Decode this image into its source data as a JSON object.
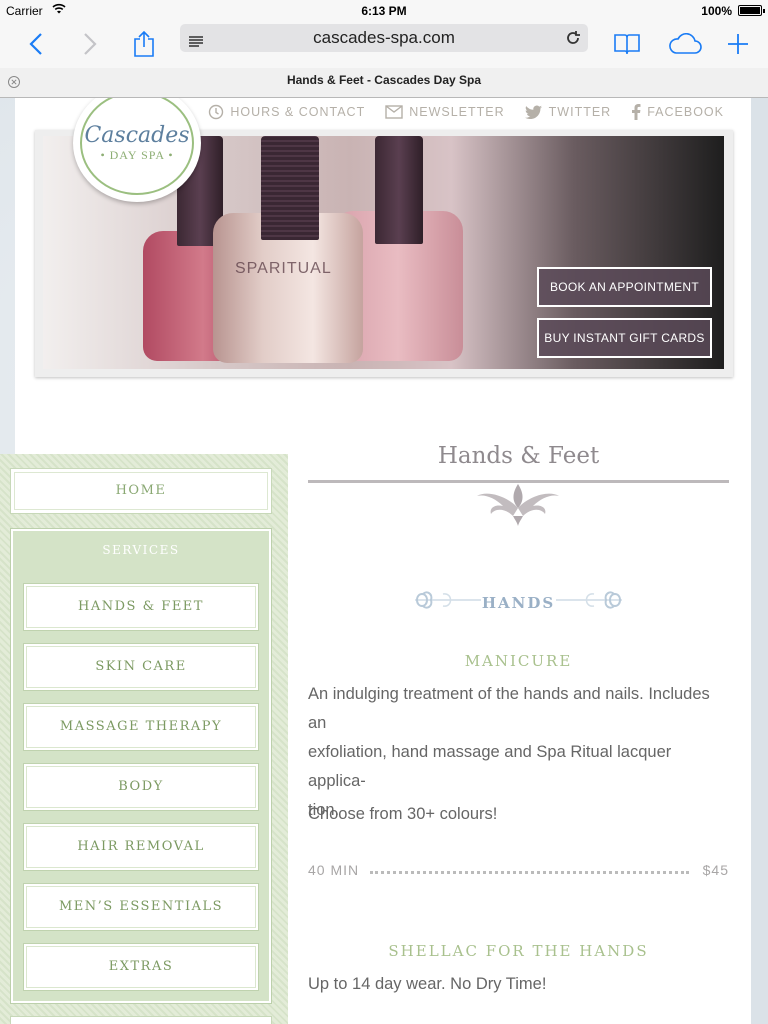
{
  "status_bar": {
    "carrier": "Carrier",
    "time": "6:13 PM",
    "battery_pct": "100%"
  },
  "browser": {
    "url": "cascades-spa.com",
    "tab_title": "Hands & Feet - Cascades Day Spa",
    "accent_color": "#1a7cf5"
  },
  "site": {
    "logo_name": "Cascades",
    "logo_sub": "• DAY SPA •",
    "top_links": {
      "hours": "HOURS & CONTACT",
      "newsletter": "NEWSLETTER",
      "twitter": "TWITTER",
      "facebook": "FACEBOOK"
    },
    "hero": {
      "book_label": "BOOK AN APPOINTMENT",
      "gift_label": "BUY INSTANT GIFT CARDS",
      "brand_text": "SPARITUAL"
    }
  },
  "sidebar": {
    "home": "HOME",
    "services_label": "SERVICES",
    "items": [
      {
        "label": "HANDS & FEET"
      },
      {
        "label": "SKIN CARE"
      },
      {
        "label": "MASSAGE THERAPY"
      },
      {
        "label": "BODY"
      },
      {
        "label": "HAIR REMOVAL"
      },
      {
        "label": "MEN’S ESSENTIALS"
      },
      {
        "label": "EXTRAS"
      }
    ]
  },
  "main": {
    "title": "Hands & Feet",
    "section": "HANDS",
    "items": [
      {
        "title": "MANICURE",
        "desc_lines": [
          "An indulging treatment of the hands and nails. Includes an",
          "exfoliation, hand massage and Spa Ritual lacquer applica-",
          "tion."
        ],
        "note": "Choose from 30+ colours!",
        "duration": "40 MIN",
        "price": "$45"
      },
      {
        "title": "SHELLAC FOR THE HANDS",
        "desc": "Up to 14 day wear. No Dry Time!"
      }
    ]
  }
}
